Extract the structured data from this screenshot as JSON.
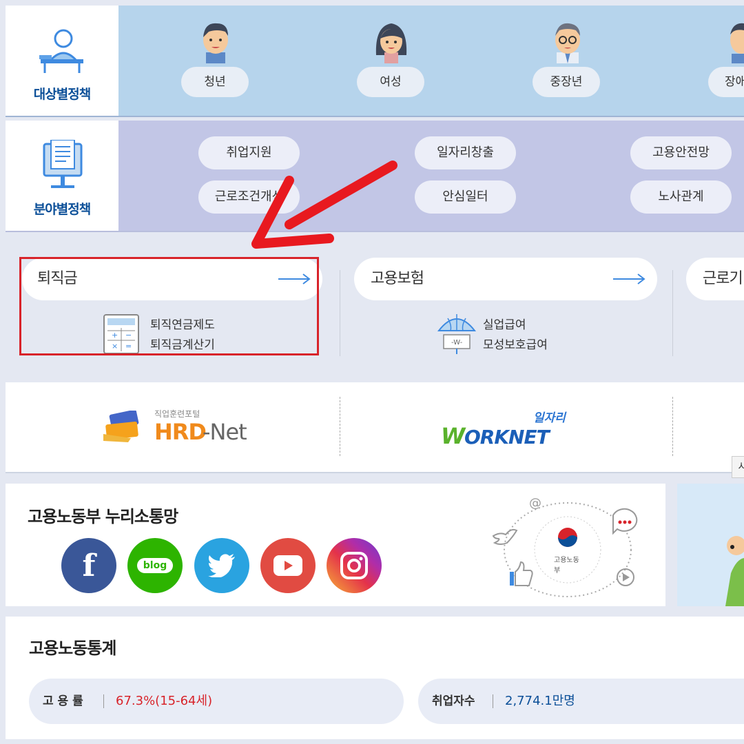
{
  "target_policy": {
    "title": "대상별정책",
    "items": [
      {
        "label": "청년"
      },
      {
        "label": "여성"
      },
      {
        "label": "중장년"
      },
      {
        "label": "장애"
      }
    ]
  },
  "field_policy": {
    "title": "분야별정책",
    "items": [
      {
        "label": "취업지원"
      },
      {
        "label": "일자리창출"
      },
      {
        "label": "고용안전망"
      },
      {
        "label": "근로조건개선"
      },
      {
        "label": "안심일터"
      },
      {
        "label": "노사관계"
      }
    ]
  },
  "service_cards": [
    {
      "title": "퇴직금",
      "links": [
        "퇴직연금제도",
        "퇴직금계산기"
      ],
      "icon": "calculator-icon"
    },
    {
      "title": "고용보험",
      "links": [
        "실업급여",
        "모성보호급여"
      ],
      "icon": "umbrella-icon"
    },
    {
      "title": "근로기"
    }
  ],
  "portals": {
    "hrd": {
      "subtitle": "직업훈련포털",
      "name_a": "HRD",
      "name_b": "-Net"
    },
    "worknet": {
      "subtitle": "일자리",
      "name_a": "W",
      "name_b": "ORKNET"
    }
  },
  "social": {
    "title": "고용노동부 누리소통망",
    "channels": [
      {
        "name": "facebook",
        "glyph": "f",
        "color": "#3a5798"
      },
      {
        "name": "blog",
        "glyph": "blog",
        "color": "#2db400"
      },
      {
        "name": "twitter",
        "glyph": "twitter-icon",
        "color": "#2aa3e0"
      },
      {
        "name": "youtube",
        "glyph": "youtube-icon",
        "color": "#e14b42"
      },
      {
        "name": "instagram",
        "glyph": "instagram-icon",
        "color": "#c32aa3"
      }
    ],
    "ministry_label": "고용노동부"
  },
  "stats": {
    "title": "고용노동통계",
    "items": [
      {
        "label": "고 용 률",
        "value": "67.3%(15-64세)",
        "color": "#d8232a"
      },
      {
        "label": "취업자수",
        "value": "2,774.1만명",
        "color": "#0b4f98"
      }
    ]
  },
  "tooltip": "시",
  "colors": {
    "accent_blue": "#0b4f98",
    "highlight_red": "#d8232a",
    "arrow_blue": "#3e8ae0"
  }
}
